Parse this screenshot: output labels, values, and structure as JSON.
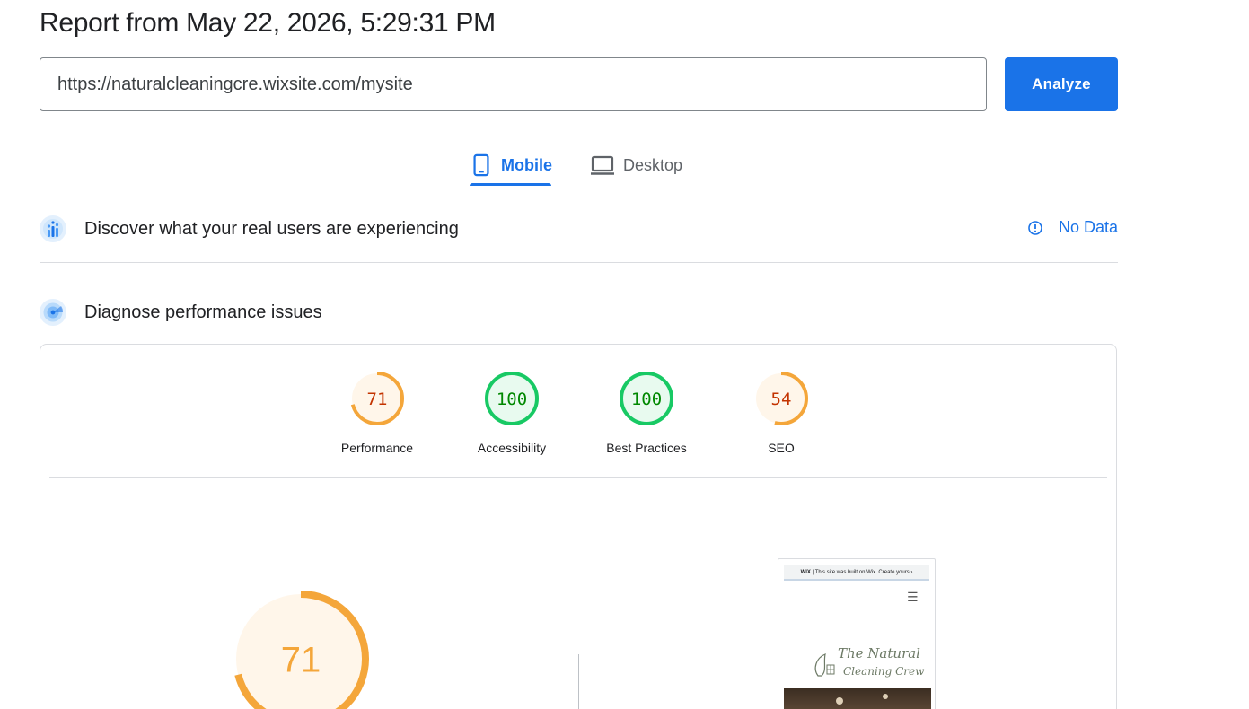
{
  "report": {
    "title": "Report from May 22, 2026, 5:29:31 PM"
  },
  "search": {
    "url_value": "https://naturalcleaningcre.wixsite.com/mysite",
    "analyze_label": "Analyze"
  },
  "tabs": {
    "mobile_label": "Mobile",
    "desktop_label": "Desktop",
    "active": "Mobile"
  },
  "field_data": {
    "title": "Discover what your real users are experiencing",
    "status": "No Data"
  },
  "lab_data": {
    "title": "Diagnose performance issues"
  },
  "scores": [
    {
      "label": "Performance",
      "value": 71,
      "text": "71",
      "color": "#f4a63a",
      "text_color": "#c33300",
      "bg": "#fff6ea"
    },
    {
      "label": "Accessibility",
      "value": 100,
      "text": "100",
      "color": "#18c964",
      "text_color": "#008800",
      "bg": "#e8faef"
    },
    {
      "label": "Best Practices",
      "value": 100,
      "text": "100",
      "color": "#18c964",
      "text_color": "#008800",
      "bg": "#e8faef"
    },
    {
      "label": "SEO",
      "value": 54,
      "text": "54",
      "color": "#f4a63a",
      "text_color": "#c33300",
      "bg": "#fff6ea"
    }
  ],
  "main_score": {
    "value": 71,
    "text": "71",
    "color": "#f4a63a",
    "bg": "#fff6ea"
  },
  "preview": {
    "banner_brand": "WIX",
    "banner_text": "| This site was built on Wix. Create yours ›",
    "menu_icon": "☰",
    "logo_line1": "The Natural",
    "logo_line2": "Cleaning Crew"
  },
  "colors": {
    "accent": "#1a73e8",
    "average": "#f4a63a",
    "pass": "#18c964"
  },
  "icons": {
    "mobile": "phone-icon",
    "desktop": "laptop-icon",
    "field": "users-chart-icon",
    "lab": "radar-icon",
    "info": "info-icon"
  }
}
